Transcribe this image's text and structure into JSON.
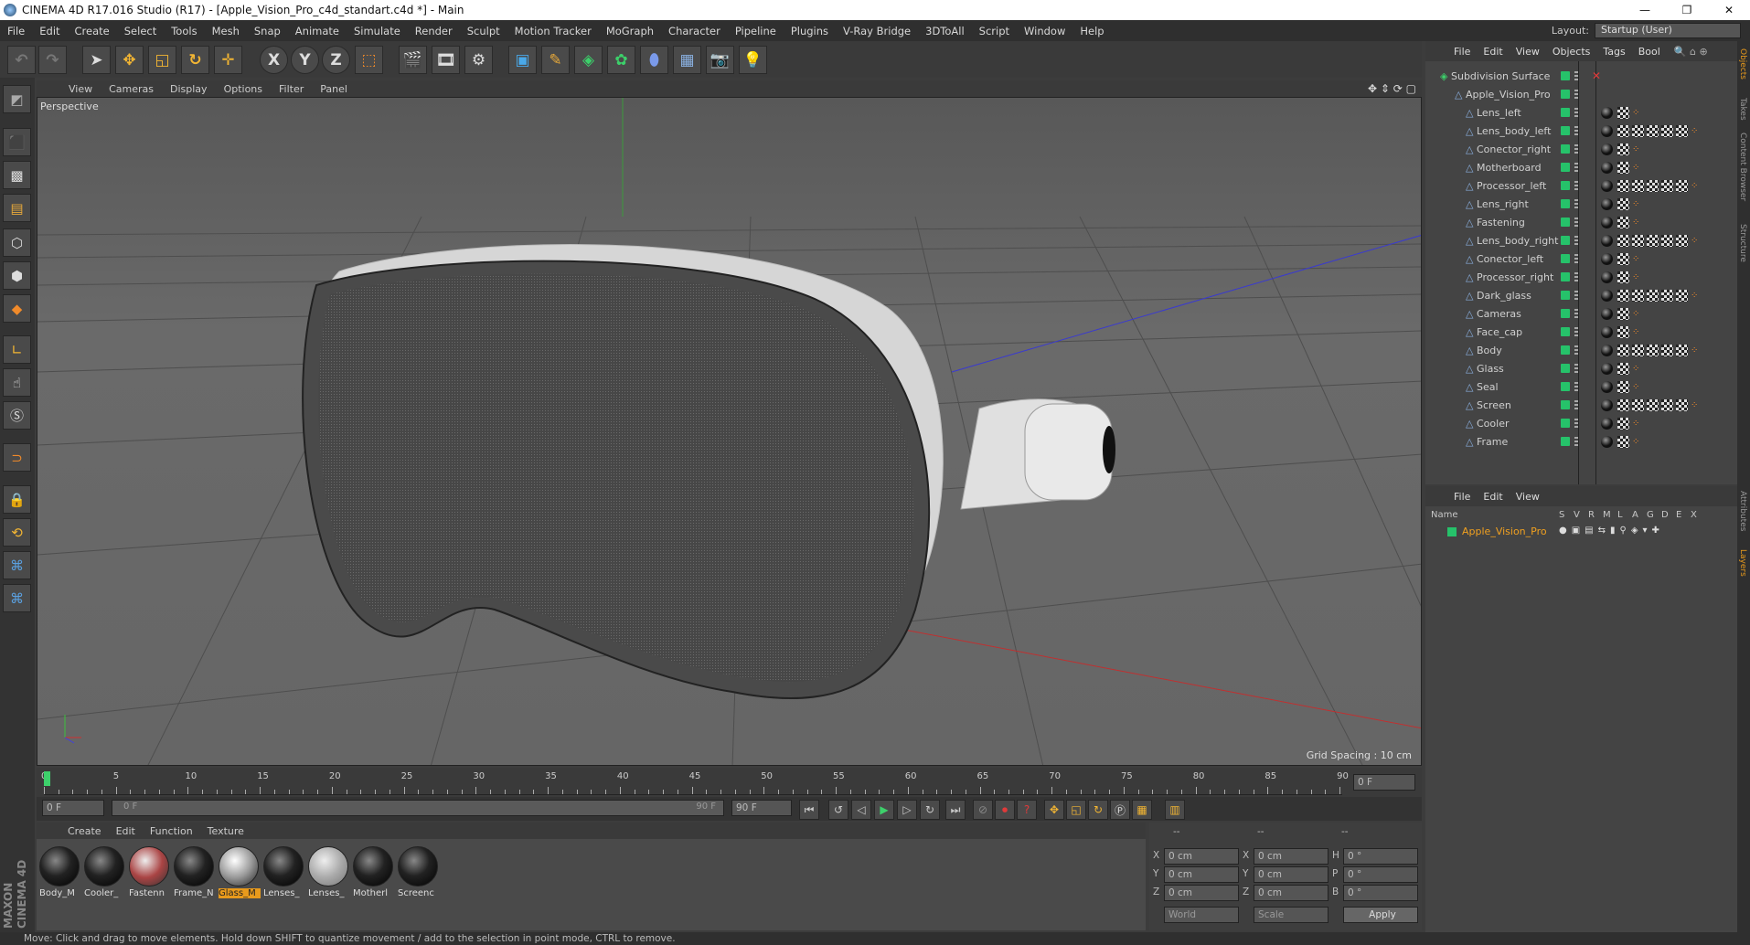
{
  "window": {
    "title": "CINEMA 4D R17.016 Studio (R17) - [Apple_Vision_Pro_c4d_standart.c4d *] - Main",
    "minimize": "—",
    "restore": "❐",
    "close": "✕"
  },
  "menubar": {
    "items": [
      "File",
      "Edit",
      "Create",
      "Select",
      "Tools",
      "Mesh",
      "Snap",
      "Animate",
      "Simulate",
      "Render",
      "Sculpt",
      "Motion Tracker",
      "MoGraph",
      "Character",
      "Pipeline",
      "Plugins",
      "V-Ray Bridge",
      "3DToAll",
      "Script",
      "Window",
      "Help"
    ],
    "layout_label": "Layout:",
    "layout_value": "Startup (User)"
  },
  "toolbar": {
    "x": "X",
    "y": "Y",
    "z": "Z"
  },
  "viewport": {
    "menu": [
      "View",
      "Cameras",
      "Display",
      "Options",
      "Filter",
      "Panel"
    ],
    "label": "Perspective",
    "grid_spacing": "Grid Spacing : 10 cm"
  },
  "timeline": {
    "ticks": [
      "0",
      "5",
      "10",
      "15",
      "20",
      "25",
      "30",
      "35",
      "40",
      "45",
      "50",
      "55",
      "60",
      "65",
      "70",
      "75",
      "80",
      "85",
      "90"
    ],
    "current_frame": "0 F",
    "start_field": "0 F",
    "range_start": "0 F",
    "range_end": "90 F",
    "end_field": "90 F",
    "playhead_fraction": 0.0
  },
  "materials": {
    "menu": [
      "Create",
      "Edit",
      "Function",
      "Texture"
    ],
    "items": [
      {
        "name": "Body_M"
      },
      {
        "name": "Cooler_"
      },
      {
        "name": "Fastenn"
      },
      {
        "name": "Frame_N"
      },
      {
        "name": "Glass_M",
        "selected": true
      },
      {
        "name": "Lenses_"
      },
      {
        "name": "Lenses_"
      },
      {
        "name": "Motherl"
      },
      {
        "name": "Screenc"
      }
    ]
  },
  "coords": {
    "header": [
      "--",
      "--",
      "--"
    ],
    "rows": [
      {
        "a": "X",
        "av": "0 cm",
        "b": "X",
        "bv": "0 cm",
        "c": "H",
        "cv": "0 °"
      },
      {
        "a": "Y",
        "av": "0 cm",
        "b": "Y",
        "bv": "0 cm",
        "c": "P",
        "cv": "0 °"
      },
      {
        "a": "Z",
        "av": "0 cm",
        "b": "Z",
        "bv": "0 cm",
        "c": "B",
        "cv": "0 °"
      }
    ],
    "world": "World",
    "scale": "Scale",
    "apply": "Apply"
  },
  "objects": {
    "menu": [
      "File",
      "Edit",
      "View",
      "Objects",
      "Tags",
      "Bool"
    ],
    "root": "Subdivision Surface",
    "group": "Apple_Vision_Pro",
    "children": [
      "Lens_left",
      "Lens_body_left",
      "Conector_right",
      "Motherboard",
      "Processor_left",
      "Lens_right",
      "Fastening",
      "Lens_body_right",
      "Conector_left",
      "Processor_right",
      "Dark_glass",
      "Cameras",
      "Face_cap",
      "Body",
      "Glass",
      "Seal",
      "Screen",
      "Cooler",
      "Frame"
    ]
  },
  "layers": {
    "menu": [
      "File",
      "Edit",
      "View"
    ],
    "name_header": "Name",
    "cols": [
      "S",
      "V",
      "R",
      "M",
      "L",
      "A",
      "G",
      "D",
      "E",
      "X"
    ],
    "layer": "Apple_Vision_Pro"
  },
  "dock_tabs": [
    "Objects",
    "Takes",
    "Content Browser",
    "Structure",
    "Attributes",
    "Layers"
  ],
  "status": "Move: Click and drag to move elements. Hold down SHIFT to quantize movement / add to the selection in point mode, CTRL to remove.",
  "brand": "MAXON CINEMA 4D"
}
